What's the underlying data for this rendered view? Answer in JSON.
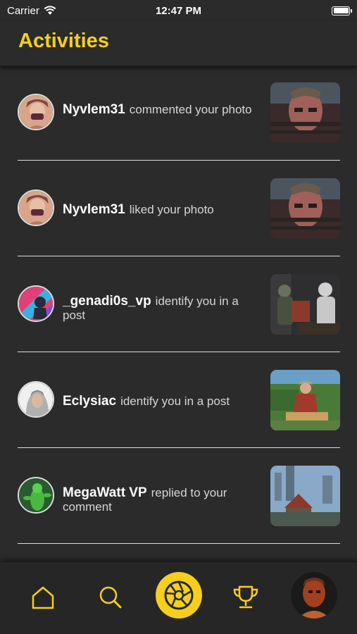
{
  "status_bar": {
    "carrier": "Carrier",
    "time": "12:47 PM"
  },
  "header": {
    "title": "Activities"
  },
  "activities": [
    {
      "username": "Nyvlem31",
      "action": "commented your photo"
    },
    {
      "username": "Nyvlem31",
      "action": "liked your photo"
    },
    {
      "username": "_genadi0s_vp",
      "action": "identify you in a post"
    },
    {
      "username": "Eclysiac",
      "action": "identify you in a post"
    },
    {
      "username": "MegaWatt VP",
      "action": "replied to your comment"
    }
  ],
  "tab_bar": {
    "items": [
      {
        "icon": "home-icon"
      },
      {
        "icon": "search-icon"
      },
      {
        "icon": "camera-shutter-icon"
      },
      {
        "icon": "trophy-icon"
      },
      {
        "icon": "profile-avatar"
      }
    ]
  },
  "colors": {
    "accent": "#f5cf1c",
    "background": "#2b2b2b"
  }
}
